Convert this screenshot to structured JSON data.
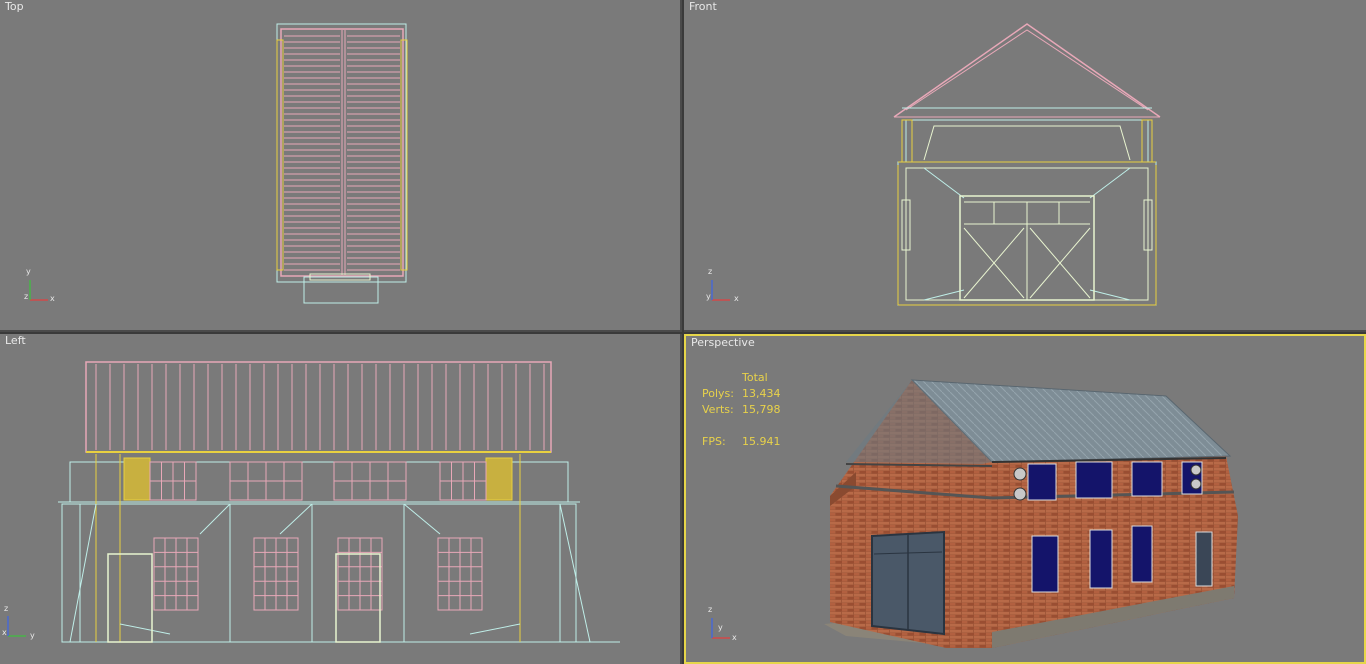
{
  "viewports": {
    "top": {
      "label": "Top"
    },
    "front": {
      "label": "Front"
    },
    "left": {
      "label": "Left"
    },
    "perspective": {
      "label": "Perspective"
    }
  },
  "stats": {
    "header": "Total",
    "polys_label": "Polys:",
    "polys_value": "13,434",
    "verts_label": "Verts:",
    "verts_value": "15,798",
    "fps_label": "FPS:",
    "fps_value": "15.941"
  },
  "gizmo": {
    "top": {
      "a": "y",
      "b": "x",
      "c": "z"
    },
    "front": {
      "a": "z",
      "b": "x",
      "c": "y"
    },
    "left": {
      "a": "z",
      "b": "y",
      "c": "x"
    },
    "perspective": {
      "a": "z",
      "b": "x",
      "c": "y"
    }
  },
  "colors": {
    "viewport_bg": "#7a7a7a",
    "active_border": "#e6d64a",
    "wire_pink": "#e8a8b8",
    "wire_cyan": "#bfeee8",
    "wire_yellow": "#e8d040",
    "wire_light": "#e8f4d0",
    "axis_x": "#ff3030",
    "axis_y": "#30d030",
    "axis_z": "#3060ff",
    "stats_text": "#e8d24a"
  }
}
